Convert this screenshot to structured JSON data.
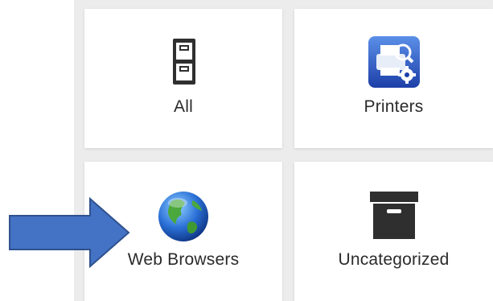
{
  "categories": [
    {
      "label": "All",
      "icon": "file-cabinet-icon"
    },
    {
      "label": "Printers",
      "icon": "printer-settings-icon"
    },
    {
      "label": "Web Browsers",
      "icon": "globe-icon"
    },
    {
      "label": "Uncategorized",
      "icon": "archive-box-icon"
    }
  ],
  "colors": {
    "arrow_fill": "#4472c4",
    "arrow_stroke": "#2f528f",
    "tile_background": "#ffffff",
    "grid_background": "#ececec"
  }
}
